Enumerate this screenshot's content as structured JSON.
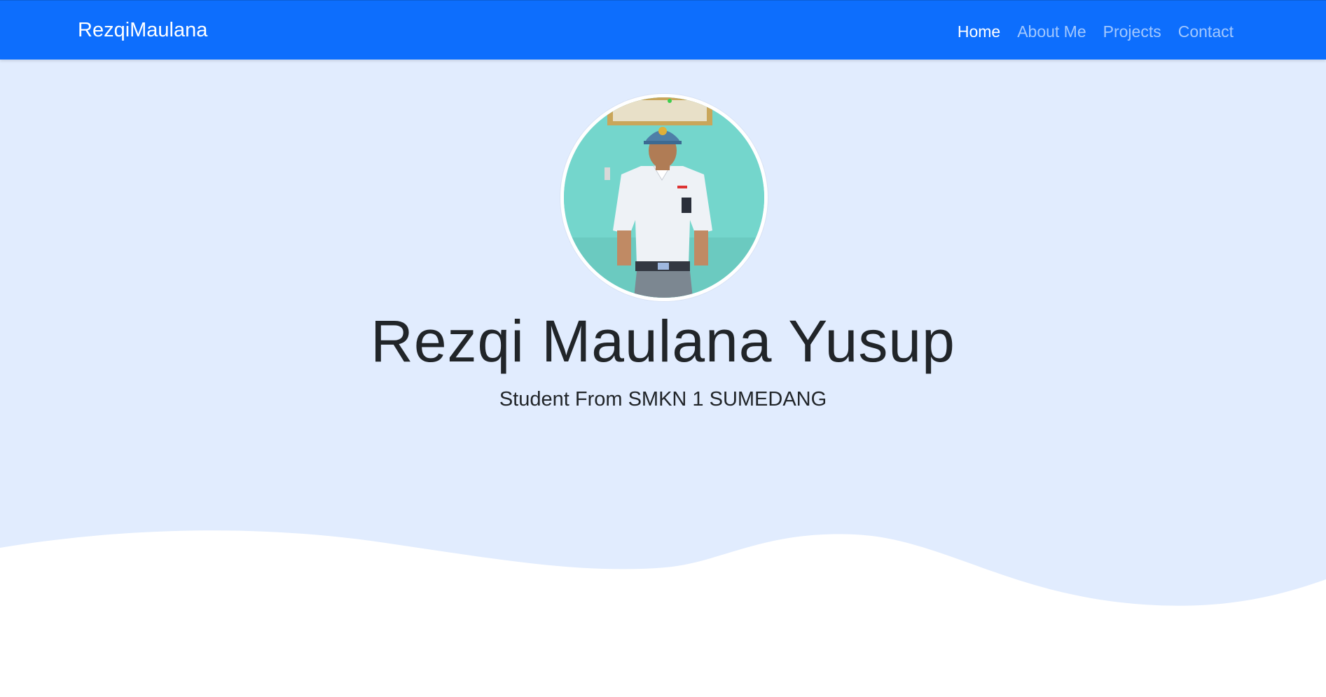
{
  "colors": {
    "navbar": "#0d6efd",
    "hero_background": "#e1ecfe",
    "wave": "#ffffff",
    "text": "#212529"
  },
  "navbar": {
    "brand": "RezqiMaulana",
    "links": [
      {
        "label": "Home",
        "active": true
      },
      {
        "label": "About Me",
        "active": false
      },
      {
        "label": "Projects",
        "active": false
      },
      {
        "label": "Contact",
        "active": false
      }
    ]
  },
  "hero": {
    "profile_image": "profile-photo",
    "name": "Rezqi Maulana Yusup",
    "subtitle": "Student From SMKN 1 SUMEDANG"
  }
}
